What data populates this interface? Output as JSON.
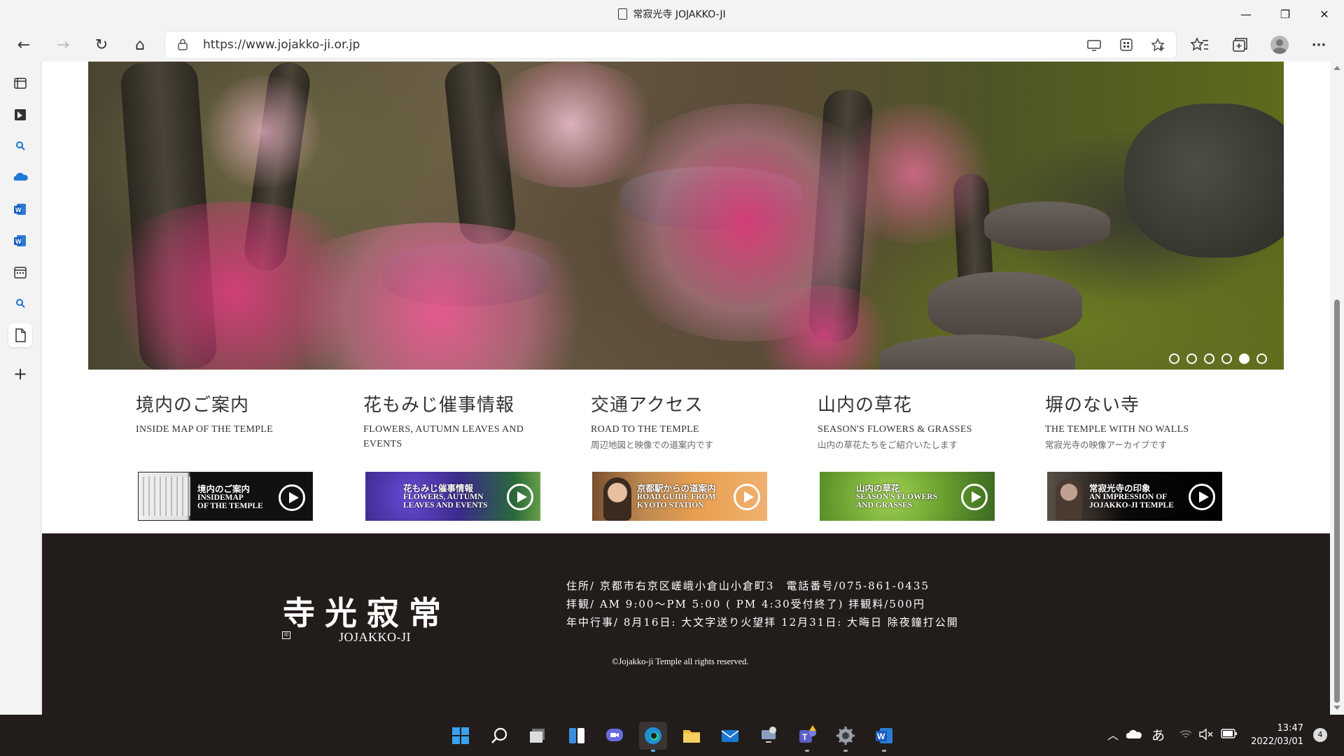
{
  "window": {
    "title": "常寂光寺 JOJAKKO-JI",
    "minimize_icon": "—",
    "restore_icon": "❐",
    "close_icon": "✕"
  },
  "toolbar": {
    "url_host": "https://www.jojakko-ji.or.jp",
    "back_icon": "←",
    "forward_icon": "→",
    "refresh_icon": "↻",
    "home_icon": "⌂",
    "more_icon": "···"
  },
  "sidebar": {
    "items": [
      "tabs-icon",
      "bing-icon",
      "search-icon",
      "onedrive-icon",
      "word-icon",
      "word-icon",
      "calendar-icon",
      "search-icon",
      "document-icon"
    ],
    "add_icon": "+"
  },
  "hero": {
    "slides": 6,
    "active_slide": 5
  },
  "menu": [
    {
      "jp": "境内のご案内",
      "en": "INSIDE MAP OF THE TEMPLE",
      "desc": ""
    },
    {
      "jp": "花もみじ催事情報",
      "en": "FLOWERS, AUTUMN LEAVES AND EVENTS",
      "desc": ""
    },
    {
      "jp": "交通アクセス",
      "en": "ROAD TO THE TEMPLE",
      "desc": "周辺地図と映像での道案内です"
    },
    {
      "jp": "山内の草花",
      "en": "SEASON'S FLOWERS & GRASSES",
      "desc": "山内の草花たちをご紹介いたします"
    },
    {
      "jp": "塀のない寺",
      "en": "THE TEMPLE WITH NO WALLS",
      "desc": "常寂光寺の映像アーカイブです"
    }
  ],
  "banners": [
    {
      "line1": "境内のご案内",
      "line2": "INSIDEMAP",
      "line3": "OF THE TEMPLE"
    },
    {
      "line1": "花もみじ催事情報",
      "line2": "FLOWERS, AUTUMN",
      "line3": "LEAVES AND EVENTS"
    },
    {
      "line1": "京都駅からの道案内",
      "line2": "ROAD GUIDE FROM",
      "line3": "KYOTO STATION"
    },
    {
      "line1": "山内の草花",
      "line2": "SEASON'S FLOWERS",
      "line3": "AND GRASSES"
    },
    {
      "line1": "常寂光寺の印象",
      "line2": "AN IMPRESSION OF",
      "line3": "JOJAKKO-JI TEMPLE"
    }
  ],
  "footer": {
    "logo_jp": "寺光寂常",
    "logo_en": "JOJAKKO-JI",
    "seal": "印",
    "address": "住所/ 京都市右京区嵯峨小倉山小倉町3　電話番号/075-861-0435",
    "hours": "拝観/ AM 9:00～PM 5:00 ( PM 4:30受付終了) 拝観料/500円",
    "events": "年中行事/ 8月16日: 大文字送り火望拝 12月31日: 大晦日 除夜鐘打公開",
    "copyright": "©Jojakko-ji Temple all rights reserved."
  },
  "taskbar": {
    "ime": "あ",
    "time": "13:47",
    "date": "2022/03/01",
    "notifications": "4"
  },
  "colors": {
    "footer_bg": "#221c1a",
    "taskbar_bg": "#221d1b",
    "edge_accent": "#1e90d6"
  }
}
